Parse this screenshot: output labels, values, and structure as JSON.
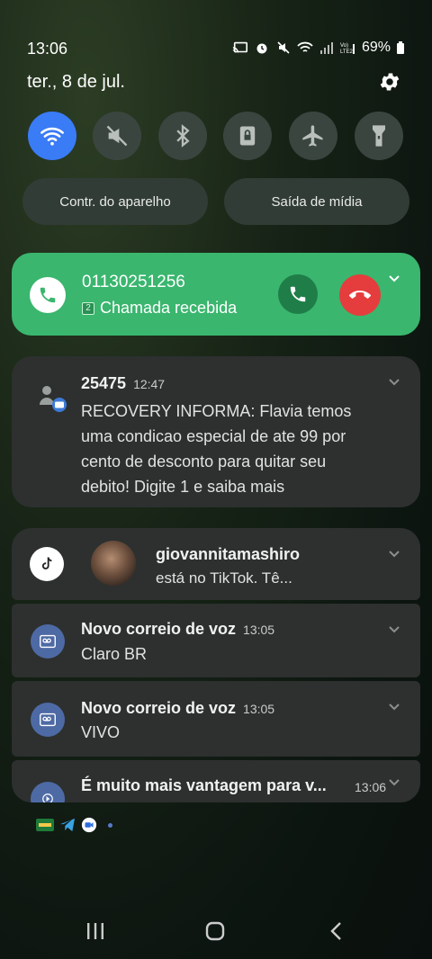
{
  "status_bar": {
    "time": "13:06",
    "battery": "69%"
  },
  "date": "ter., 8 de jul.",
  "quick_settings": [
    "wifi",
    "mute",
    "bluetooth",
    "screen-lock",
    "airplane",
    "flashlight"
  ],
  "buttons": {
    "device_control": "Contr. do aparelho",
    "media_output": "Saída de mídia"
  },
  "call": {
    "number": "01130251256",
    "status": "Chamada recebida",
    "sim": "2"
  },
  "sms": {
    "sender": "25475",
    "time": "12:47",
    "lines": [
      "RECOVERY INFORMA: Flavia temos",
      "uma condicao especial de ate 99 por",
      "cento de desconto para quitar seu",
      "debito! Digite 1 e saiba mais"
    ]
  },
  "tiktok": {
    "user": "giovannitamashiro",
    "text": "está no TikTok. Tê..."
  },
  "voicemail1": {
    "title": "Novo correio de voz",
    "time": "13:05",
    "text": "Claro BR"
  },
  "voicemail2": {
    "title": "Novo correio de voz",
    "time": "13:05",
    "text": "VIVO"
  },
  "promo": {
    "title": "É muito mais vantagem para v...",
    "time": "13:06"
  },
  "colors": {
    "call_green": "#3ab66e",
    "decline_red": "#e53d3d",
    "wifi_blue": "#3a7bf6"
  }
}
